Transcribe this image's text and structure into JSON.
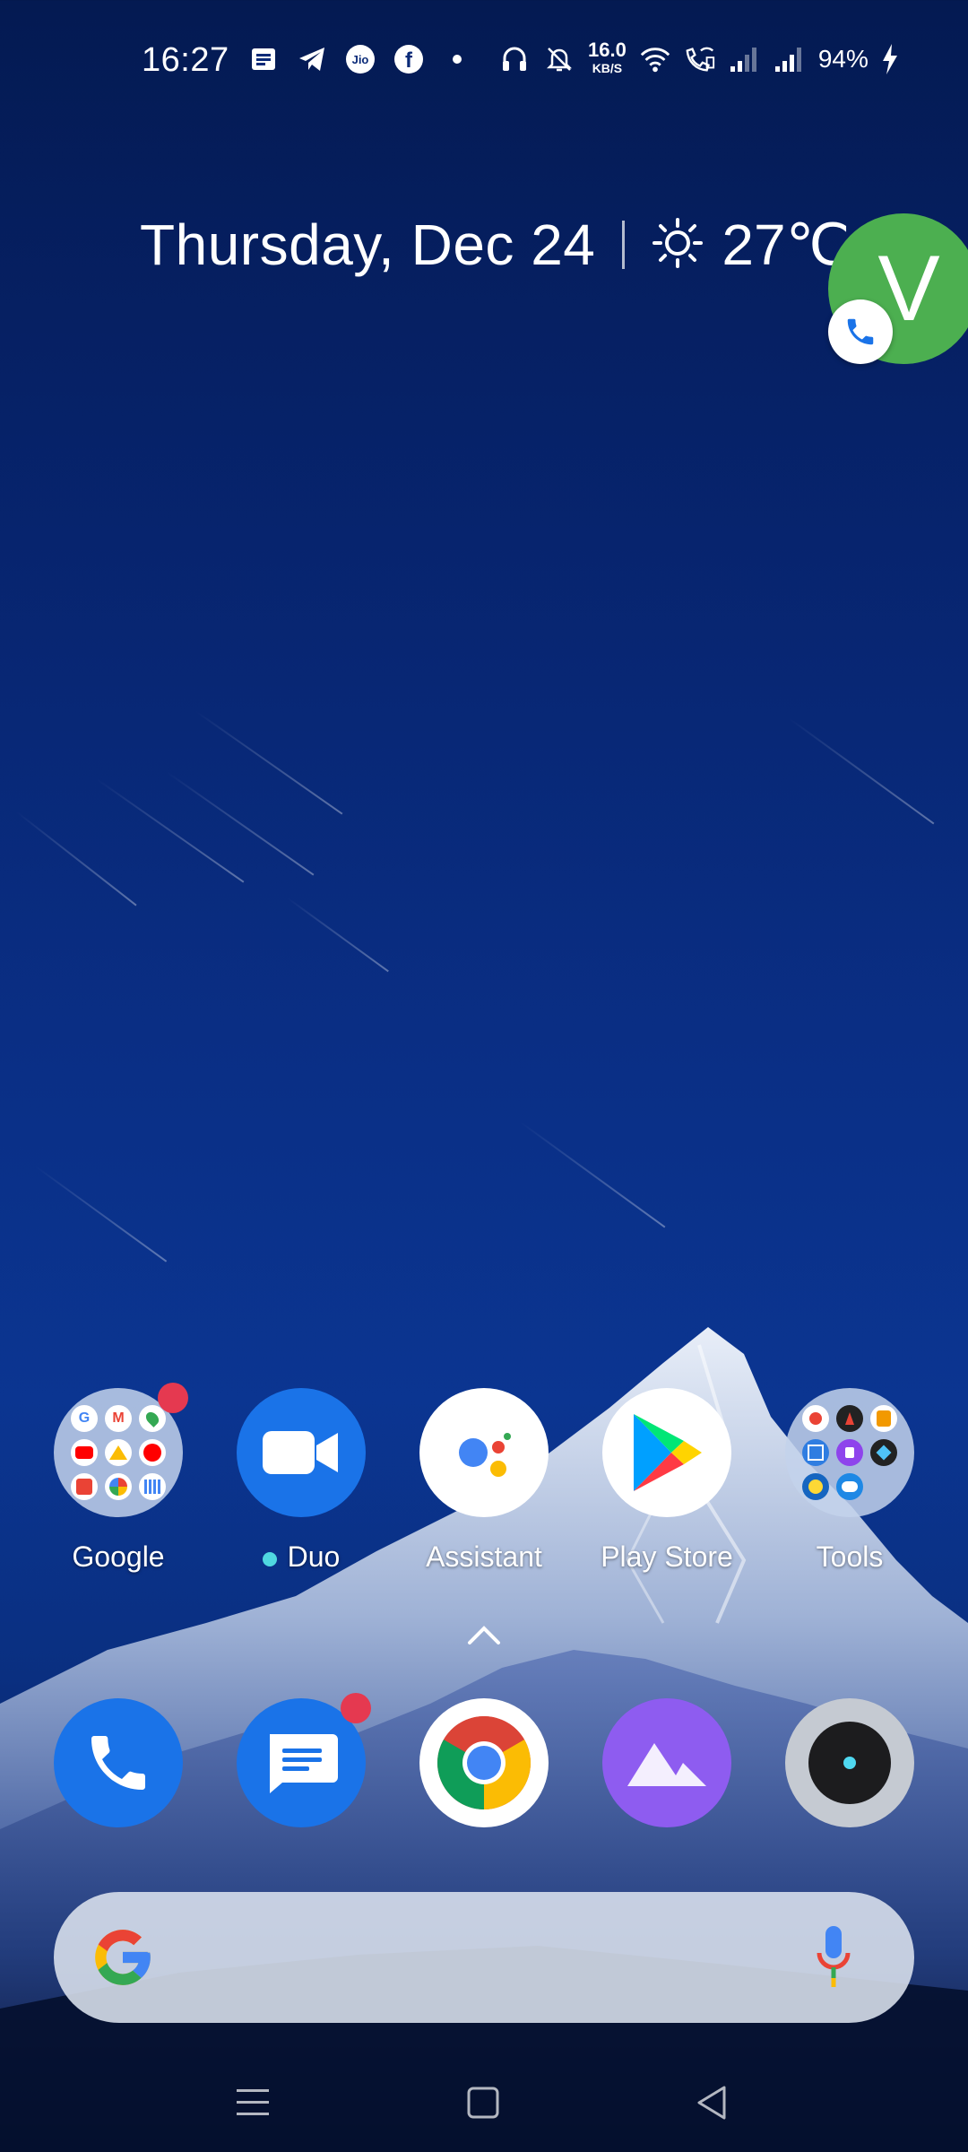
{
  "status_bar": {
    "time": "16:27",
    "net_speed_value": "16.0",
    "net_speed_unit": "KB/S",
    "battery_percent": "94%",
    "left_icons": [
      "news-icon",
      "telegram-icon",
      "jio-icon",
      "facebook-icon",
      "dot-icon"
    ],
    "right_icons": [
      "headphones-icon",
      "bell-off-icon",
      "wifi-icon",
      "wifi-calling-icon",
      "signal-1-icon",
      "signal-2-icon",
      "charging-icon"
    ],
    "jio_label": "Jio"
  },
  "widget": {
    "date": "Thursday, Dec 24",
    "temperature": "27℃",
    "weather_icon": "sun-icon"
  },
  "call_bubble": {
    "initial": "V",
    "color": "#4caf50"
  },
  "home_apps": [
    {
      "label": "Google",
      "type": "folder",
      "badge": true
    },
    {
      "label": "Duo",
      "type": "app",
      "badge": false,
      "status_dot": true
    },
    {
      "label": "Assistant",
      "type": "app",
      "badge": false
    },
    {
      "label": "Play Store",
      "type": "app",
      "badge": false
    },
    {
      "label": "Tools",
      "type": "folder",
      "badge": false
    }
  ],
  "dock_apps": [
    {
      "name": "Phone",
      "icon": "phone-icon"
    },
    {
      "name": "Messages",
      "icon": "messages-icon",
      "badge": true
    },
    {
      "name": "Chrome",
      "icon": "chrome-icon"
    },
    {
      "name": "Gallery",
      "icon": "gallery-icon"
    },
    {
      "name": "Camera",
      "icon": "camera-icon"
    }
  ],
  "search_bar": {
    "logo_icon": "google-g-icon",
    "mic_icon": "mic-icon"
  },
  "nav_bar": {
    "buttons": [
      "menu-icon",
      "home-icon",
      "back-icon"
    ]
  },
  "colors": {
    "badge": "#e53950",
    "accent_blue": "#1a73e8",
    "bubble_green": "#4caf50"
  }
}
